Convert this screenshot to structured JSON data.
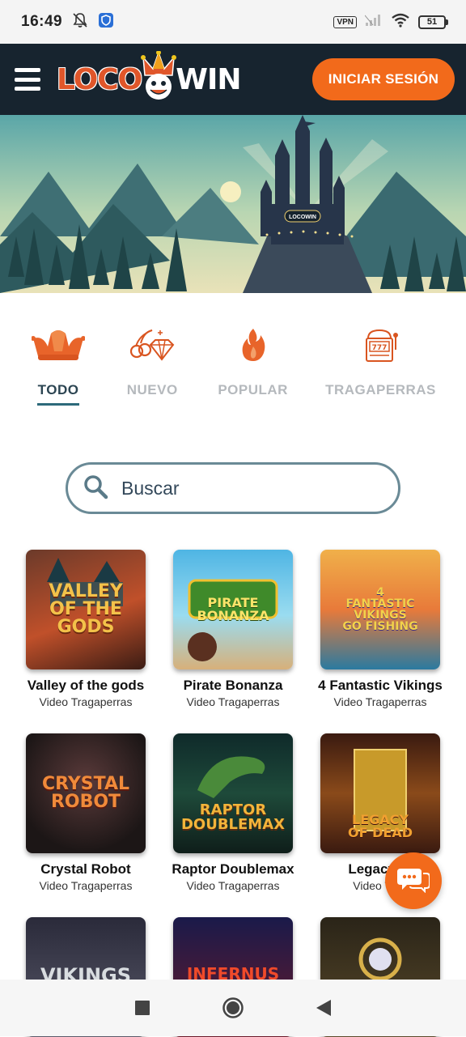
{
  "status_bar": {
    "time": "16:49",
    "vpn_label": "VPN",
    "battery": "51",
    "icons": [
      "bell-muted-icon",
      "shield-app-icon",
      "vpn-icon",
      "signal-icon",
      "wifi-icon",
      "battery-icon"
    ]
  },
  "header": {
    "logo_left": "LOCO",
    "logo_right": "WIN",
    "login_label": "INICIAR SESIÓN",
    "accent": "#f26a1b",
    "background": "#17242f"
  },
  "hero": {
    "banner_sign": "LOCOWIN"
  },
  "categories": [
    {
      "label": "TODO",
      "icon": "jester-hat-icon",
      "active": true
    },
    {
      "label": "NUEVO",
      "icon": "cherry-diamond-icon",
      "active": false
    },
    {
      "label": "POPULAR",
      "icon": "flame-icon",
      "active": false
    },
    {
      "label": "TRAGAPERRAS",
      "icon": "slot-machine-icon",
      "active": false
    }
  ],
  "search": {
    "placeholder": "Buscar"
  },
  "games": [
    {
      "name": "Valley of the gods",
      "category": "Video Tragaperras",
      "art": "VALLEY\nOF THE\nGODS"
    },
    {
      "name": "Pirate Bonanza",
      "category": "Video Tragaperras",
      "art": "PIRATE\nBONANZA"
    },
    {
      "name": "4 Fantastic Vikings",
      "category": "Video Tragaperras",
      "art": "4\nFANTASTIC\nVIKINGS\nGO FISHING"
    },
    {
      "name": "Crystal Robot",
      "category": "Video Tragaperras",
      "art": "CRYSTAL\nROBOT"
    },
    {
      "name": "Raptor Doublemax",
      "category": "Video Tragaperras",
      "art": "RAPTOR\nDOUBLEMAX"
    },
    {
      "name": "Legacy of",
      "category": "Video Trag",
      "art": "LEGACY\nOF DEAD"
    },
    {
      "name": "",
      "category": "",
      "art": "VIKINGS"
    },
    {
      "name": "",
      "category": "",
      "art": "INFERNUS"
    },
    {
      "name": "",
      "category": "",
      "art": ""
    }
  ],
  "nav": [
    "recents-square-icon",
    "home-circle-icon",
    "back-triangle-icon"
  ]
}
